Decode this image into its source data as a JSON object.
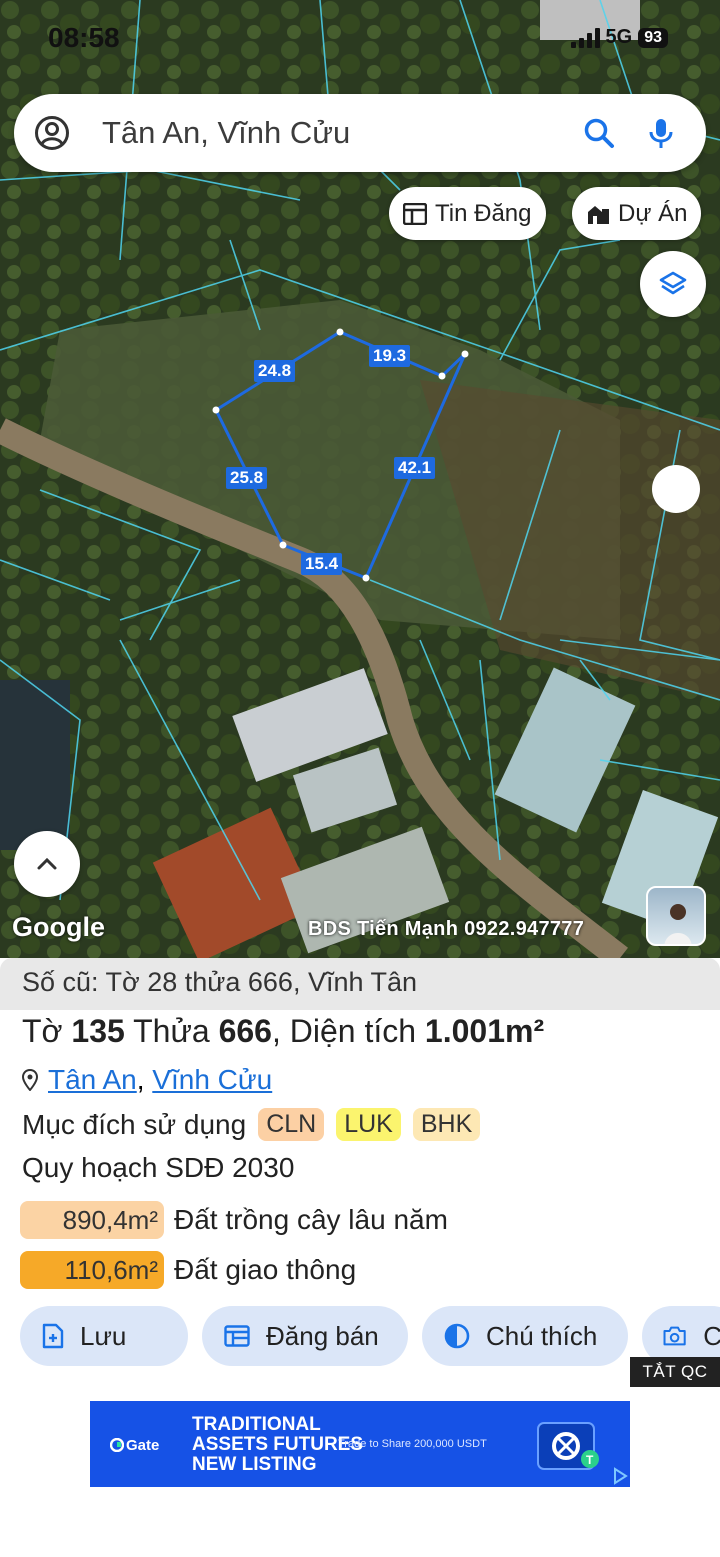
{
  "status_bar": {
    "time": "08:58",
    "network": "5G",
    "battery": "93"
  },
  "search": {
    "query": "Tân An, Vĩnh Cửu"
  },
  "map": {
    "chips": {
      "listings": "Tin Đăng",
      "projects": "Dự Án"
    },
    "attribution": "Google",
    "watermark": "BDS Tiến Mạnh 0922.947777",
    "dimensions": [
      "24.8",
      "19.3",
      "25.8",
      "42.1",
      "15.4"
    ],
    "plot_color": "#1e6ae0"
  },
  "info": {
    "old_parcel": "Số cũ: Tờ 28 thửa 666, Vĩnh Tân",
    "sheet_label": "Tờ",
    "sheet": "135",
    "parcel_label": "Thửa",
    "parcel": "666",
    "area_label": "Diện tích",
    "area": "1.001m²",
    "commune": "Tân An",
    "district": "Vĩnh Cửu",
    "purpose_label": "Mục đích sử dụng",
    "purpose_tags": [
      "CLN",
      "LUK",
      "BHK"
    ],
    "planning_label": "Quy hoạch SDĐ 2030",
    "planning": [
      {
        "area": "890,4m²",
        "use": "Đất trồng cây lâu năm",
        "color": "#fbd3a4"
      },
      {
        "area": "110,6m²",
        "use": "Đất giao thông",
        "color": "#f6a928"
      }
    ]
  },
  "actions": {
    "save": "Lưu",
    "post_sale": "Đăng bán",
    "legend": "Chú thích",
    "capture": "C"
  },
  "ad": {
    "close_label": "TẮT QC",
    "brand": "Gate",
    "headline_1": "TRADITIONAL",
    "headline_2": "ASSETS FUTURES",
    "headline_3": "NEW LISTING",
    "tagline": "Trade to Share 200,000 USDT"
  }
}
